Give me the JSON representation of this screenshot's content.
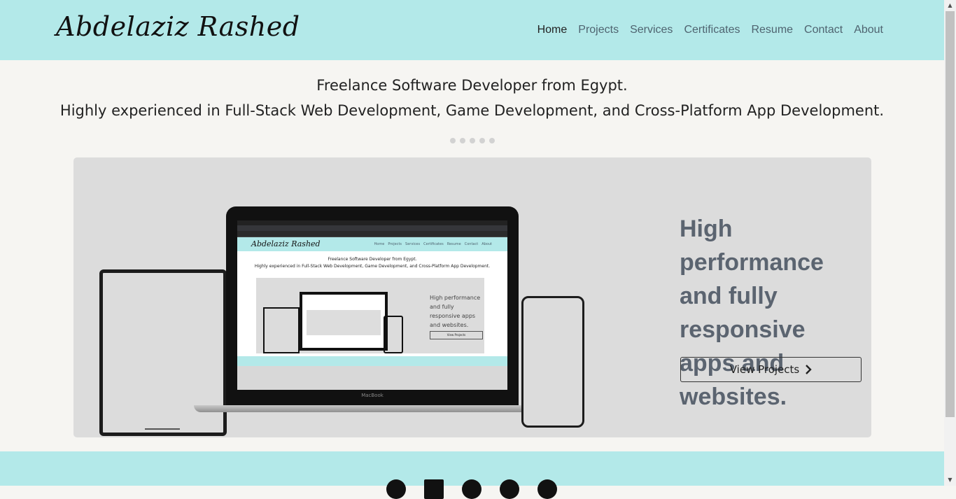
{
  "header": {
    "brand": "Abdelaziz Rashed",
    "nav": [
      "Home",
      "Projects",
      "Services",
      "Certificates",
      "Resume",
      "Contact",
      "About"
    ],
    "active": "Home"
  },
  "intro": {
    "line1": "Freelance Software Developer from Egypt.",
    "line2": "Highly experienced in Full-Stack Web Development, Game Development, and Cross-Platform App Development."
  },
  "carousel": {
    "indicator_count": 5,
    "headline": "High performance and fully responsive apps and websites.",
    "button_label": "View Projects",
    "button_icon": "chevron-right-icon"
  },
  "mockup": {
    "brand": "Abdelaziz Rashed",
    "nav": [
      "Home",
      "Projects",
      "Services",
      "Certificates",
      "Resume",
      "Contact",
      "About"
    ],
    "line1": "Freelance Software Developer from Egypt.",
    "line2": "Highly experienced in Full-Stack Web Development, Game Development, and Cross-Platform App Development.",
    "headline": "High performance and fully responsive apps and websites.",
    "button_label": "View Projects",
    "laptop_label": "MacBook"
  },
  "footer": {
    "social_icons": [
      "whatsapp-icon",
      "linkedin-icon",
      "facebook-icon",
      "messenger-icon",
      "github-icon"
    ]
  },
  "colors": {
    "accent": "#b3e9e9",
    "background": "#f6f5f2",
    "slide": "#dcdcdc",
    "headline": "#5b6470"
  }
}
